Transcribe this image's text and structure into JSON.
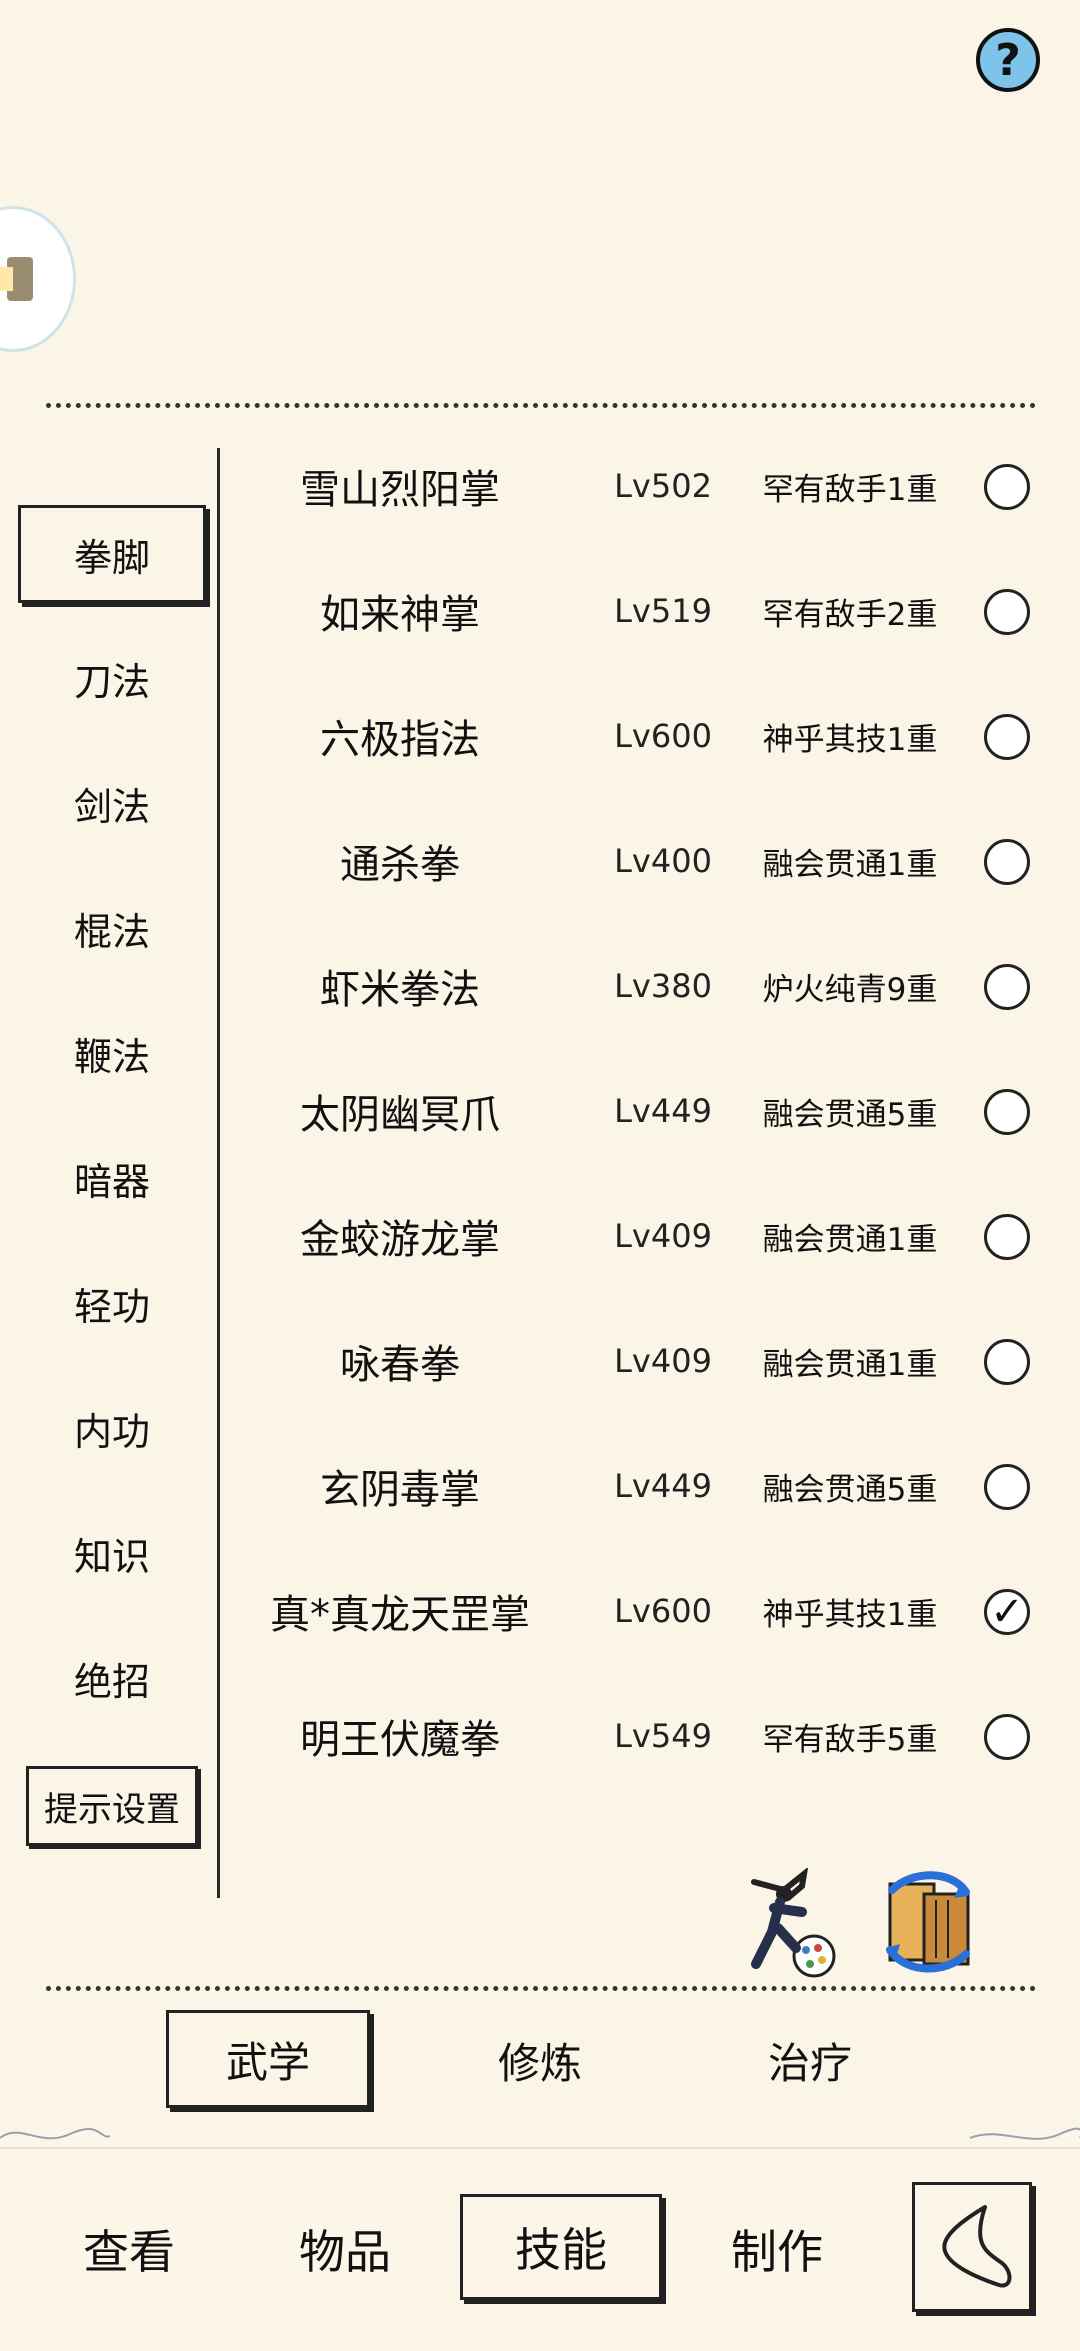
{
  "help": {
    "label": "?"
  },
  "categories": [
    {
      "label": "拳脚",
      "active": true
    },
    {
      "label": "刀法",
      "active": false
    },
    {
      "label": "剑法",
      "active": false
    },
    {
      "label": "棍法",
      "active": false
    },
    {
      "label": "鞭法",
      "active": false
    },
    {
      "label": "暗器",
      "active": false
    },
    {
      "label": "轻功",
      "active": false
    },
    {
      "label": "内功",
      "active": false
    },
    {
      "label": "知识",
      "active": false
    },
    {
      "label": "绝招",
      "active": false
    }
  ],
  "hint_settings": "提示设置",
  "skills": [
    {
      "name": "雪山烈阳掌",
      "level": "Lv502",
      "rank": "罕有敌手1重",
      "checked": false
    },
    {
      "name": "如来神掌",
      "level": "Lv519",
      "rank": "罕有敌手2重",
      "checked": false
    },
    {
      "name": "六极指法",
      "level": "Lv600",
      "rank": "神乎其技1重",
      "checked": false
    },
    {
      "name": "通杀拳",
      "level": "Lv400",
      "rank": "融会贯通1重",
      "checked": false
    },
    {
      "name": "虾米拳法",
      "level": "Lv380",
      "rank": "炉火纯青9重",
      "checked": false
    },
    {
      "name": "太阴幽冥爪",
      "level": "Lv449",
      "rank": "融会贯通5重",
      "checked": false
    },
    {
      "name": "金蛟游龙掌",
      "level": "Lv409",
      "rank": "融会贯通1重",
      "checked": false
    },
    {
      "name": "咏春拳",
      "level": "Lv409",
      "rank": "融会贯通1重",
      "checked": false
    },
    {
      "name": "玄阴毒掌",
      "level": "Lv449",
      "rank": "融会贯通5重",
      "checked": false
    },
    {
      "name": "真*真龙天罡掌",
      "level": "Lv600",
      "rank": "神乎其技1重",
      "checked": true
    },
    {
      "name": "明王伏魔拳",
      "level": "Lv549",
      "rank": "罕有敌手5重",
      "checked": false
    }
  ],
  "subtabs": [
    {
      "label": "武学",
      "active": true
    },
    {
      "label": "修炼",
      "active": false
    },
    {
      "label": "治疗",
      "active": false
    }
  ],
  "bottom_tabs": [
    {
      "label": "查看",
      "active": false
    },
    {
      "label": "物品",
      "active": false
    },
    {
      "label": "技能",
      "active": true
    },
    {
      "label": "制作",
      "active": false
    }
  ],
  "check_mark": "✓",
  "icons": {
    "help": "question-icon",
    "hero": "martial-artist-icon",
    "swap": "swap-scroll-icon",
    "back": "back-arrow-icon"
  }
}
